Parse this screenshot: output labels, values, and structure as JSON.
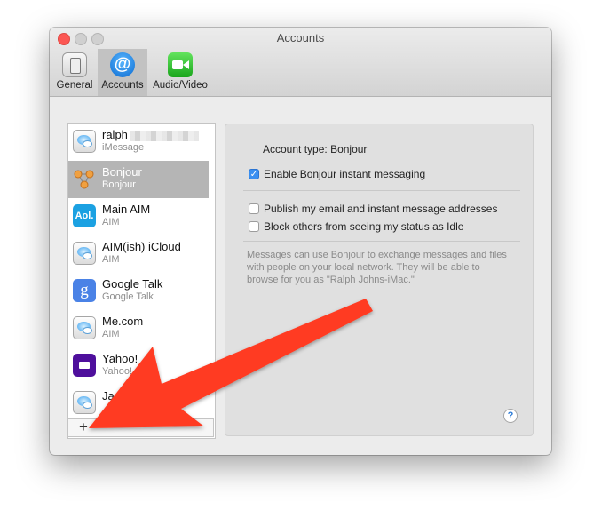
{
  "window": {
    "title": "Accounts"
  },
  "toolbar": {
    "items": [
      {
        "label": "General",
        "icon": "general-switch-icon"
      },
      {
        "label": "Accounts",
        "icon": "at-sign-icon",
        "glyph": "@"
      },
      {
        "label": "Audio/Video",
        "icon": "video-camera-icon"
      }
    ]
  },
  "accounts": [
    {
      "name": "ralph",
      "type": "iMessage",
      "icon": "messages-icon"
    },
    {
      "name": "Bonjour",
      "type": "Bonjour",
      "icon": "bonjour-icon",
      "selected": true
    },
    {
      "name": "Main AIM",
      "type": "AIM",
      "icon": "aol-icon",
      "icon_text": "Aol."
    },
    {
      "name": "AIM(ish) iCloud",
      "type": "AIM",
      "icon": "messages-icon"
    },
    {
      "name": "Google Talk",
      "type": "Google Talk",
      "icon": "google-icon",
      "icon_text": "g"
    },
    {
      "name": "Me.com",
      "type": "AIM",
      "icon": "messages-icon"
    },
    {
      "name": "Yahoo!",
      "type": "Yahoo!",
      "icon": "yahoo-icon"
    },
    {
      "name": "Ja",
      "type": "",
      "icon": "messages-icon"
    }
  ],
  "list_footer": {
    "add_label": "+",
    "remove_label": "−"
  },
  "detail": {
    "account_type_label": "Account type:",
    "account_type_value": "Bonjour",
    "enable_label": "Enable Bonjour instant messaging",
    "enable_checked": true,
    "publish_label": "Publish my email and instant message addresses",
    "publish_checked": false,
    "block_label": "Block others from seeing my status as Idle",
    "block_checked": false,
    "description": "Messages can use Bonjour to exchange messages and files with people on your local network.  They will be able to browse for you as \"Ralph Johns-iMac.\"",
    "help_label": "?"
  },
  "annotation": {
    "arrow_color": "#ff3b22"
  }
}
